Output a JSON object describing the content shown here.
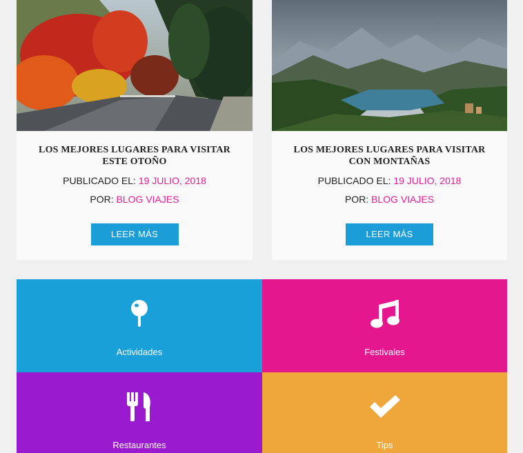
{
  "posts": [
    {
      "title": "LOS MEJORES LUGARES PARA VISITAR ESTE OTOÑO",
      "published_label": "PUBLICADO EL:",
      "date": "19 JULIO, 2018",
      "by_label": "POR:",
      "author": "BLOG VIAJES",
      "button": "LEER MÁS"
    },
    {
      "title": "LOS MEJORES LUGARES PARA VISITAR CON MONTAÑAS",
      "published_label": "PUBLICADO EL:",
      "date": "19 JULIO, 2018",
      "by_label": "POR:",
      "author": "BLOG VIAJES",
      "button": "LEER MÁS"
    }
  ],
  "categories": [
    {
      "label": "Actividades",
      "icon": "map-pin-icon",
      "color": "#1aa0d9"
    },
    {
      "label": "Festivales",
      "icon": "music-note-icon",
      "color": "#e5178f"
    },
    {
      "label": "Restaurantes",
      "icon": "fork-knife-icon",
      "color": "#9a1ad0"
    },
    {
      "label": "Tips",
      "icon": "check-icon",
      "color": "#efa63a"
    }
  ],
  "colors": {
    "accent": "#e21e96",
    "button": "#1b9dd8"
  }
}
